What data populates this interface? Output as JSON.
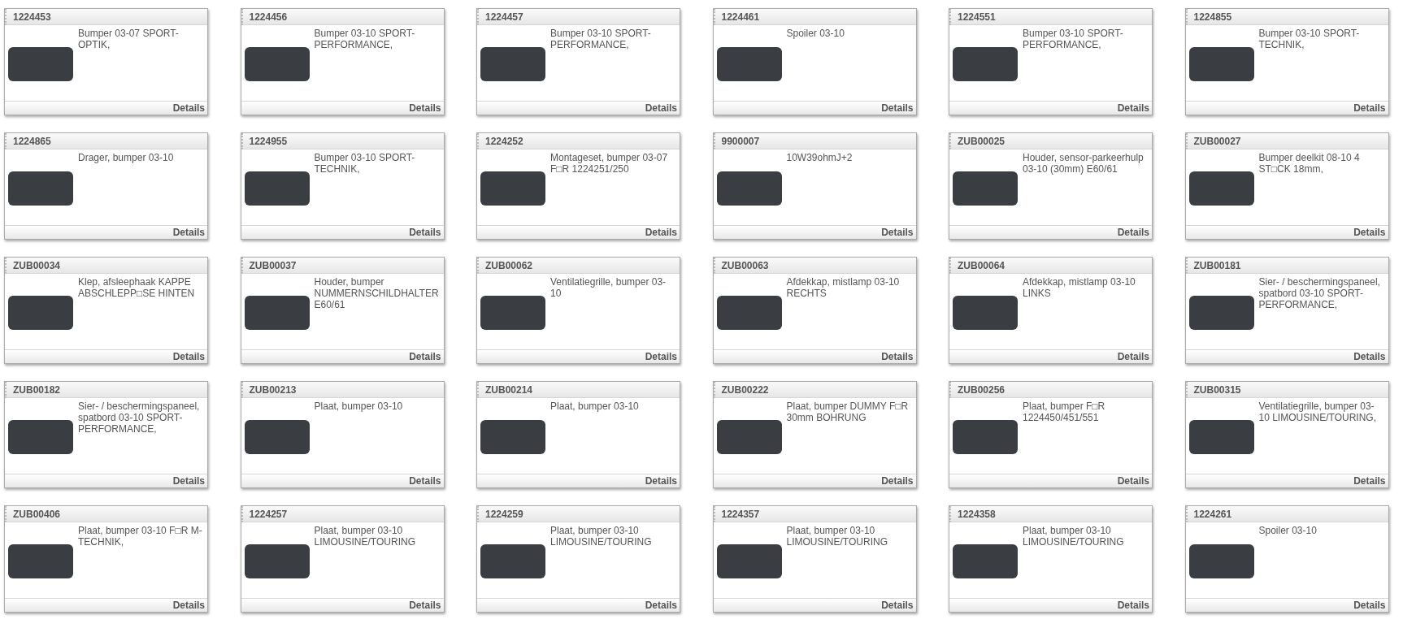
{
  "products": [
    {
      "code": "1224453",
      "description": "Bumper 03-07 SPORT-OPTIK,",
      "link": "Details"
    },
    {
      "code": "1224456",
      "description": "Bumper 03-10 SPORT-PERFORMANCE,",
      "link": "Details"
    },
    {
      "code": "1224457",
      "description": "Bumper 03-10 SPORT-PERFORMANCE,",
      "link": "Details"
    },
    {
      "code": "1224461",
      "description": "Spoiler 03-10",
      "link": "Details"
    },
    {
      "code": "1224551",
      "description": "Bumper 03-10 SPORT-PERFORMANCE,",
      "link": "Details"
    },
    {
      "code": "1224855",
      "description": "Bumper 03-10 SPORT-TECHNIK,",
      "link": "Details"
    },
    {
      "code": "1224865",
      "description": "Drager, bumper 03-10",
      "link": "Details"
    },
    {
      "code": "1224955",
      "description": "Bumper 03-10 SPORT-TECHNIK,",
      "link": "Details"
    },
    {
      "code": "1224252",
      "description": "Montageset, bumper 03-07 F□R 1224251/250",
      "link": "Details"
    },
    {
      "code": "9900007",
      "description": "10W39ohmJ+2",
      "link": "Details"
    },
    {
      "code": "ZUB00025",
      "description": "Houder, sensor-parkeerhulp 03-10 (30mm) E60/61",
      "link": "Details"
    },
    {
      "code": "ZUB00027",
      "description": "Bumper deelkit 08-10 4 ST□CK 18mm,",
      "link": "Details"
    },
    {
      "code": "ZUB00034",
      "description": "Klep, afsleephaak KAPPE ABSCHLEPP□SE HINTEN",
      "link": "Details"
    },
    {
      "code": "ZUB00037",
      "description": "Houder, bumper NUMMERNSCHILDHALTER E60/61",
      "link": "Details"
    },
    {
      "code": "ZUB00062",
      "description": "Ventilatiegrille, bumper 03-10",
      "link": "Details"
    },
    {
      "code": "ZUB00063",
      "description": "Afdekkap, mistlamp 03-10 RECHTS",
      "link": "Details"
    },
    {
      "code": "ZUB00064",
      "description": "Afdekkap, mistlamp 03-10 LINKS",
      "link": "Details"
    },
    {
      "code": "ZUB00181",
      "description": "Sier- / beschermingspaneel, spatbord 03-10 SPORT-PERFORMANCE,",
      "link": "Details"
    },
    {
      "code": "ZUB00182",
      "description": "Sier- / beschermingspaneel, spatbord 03-10 SPORT-PERFORMANCE,",
      "link": "Details"
    },
    {
      "code": "ZUB00213",
      "description": "Plaat, bumper 03-10",
      "link": "Details"
    },
    {
      "code": "ZUB00214",
      "description": "Plaat, bumper 03-10",
      "link": "Details"
    },
    {
      "code": "ZUB00222",
      "description": "Plaat, bumper DUMMY F□R 30mm BOHRUNG",
      "link": "Details"
    },
    {
      "code": "ZUB00256",
      "description": "Plaat, bumper F□R 1224450/451/551",
      "link": "Details"
    },
    {
      "code": "ZUB00315",
      "description": "Ventilatiegrille, bumper 03-10 LIMOUSINE/TOURING,",
      "link": "Details"
    },
    {
      "code": "ZUB00406",
      "description": "Plaat, bumper 03-10 F□R M-TECHNIK,",
      "link": "Details"
    },
    {
      "code": "1224257",
      "description": "Plaat, bumper 03-10 LIMOUSINE/TOURING",
      "link": "Details"
    },
    {
      "code": "1224259",
      "description": "Plaat, bumper 03-10 LIMOUSINE/TOURING",
      "link": "Details"
    },
    {
      "code": "1224357",
      "description": "Plaat, bumper 03-10 LIMOUSINE/TOURING",
      "link": "Details"
    },
    {
      "code": "1224358",
      "description": "Plaat, bumper 03-10 LIMOUSINE/TOURING",
      "link": "Details"
    },
    {
      "code": "1224261",
      "description": "Spoiler 03-10",
      "link": "Details"
    }
  ]
}
